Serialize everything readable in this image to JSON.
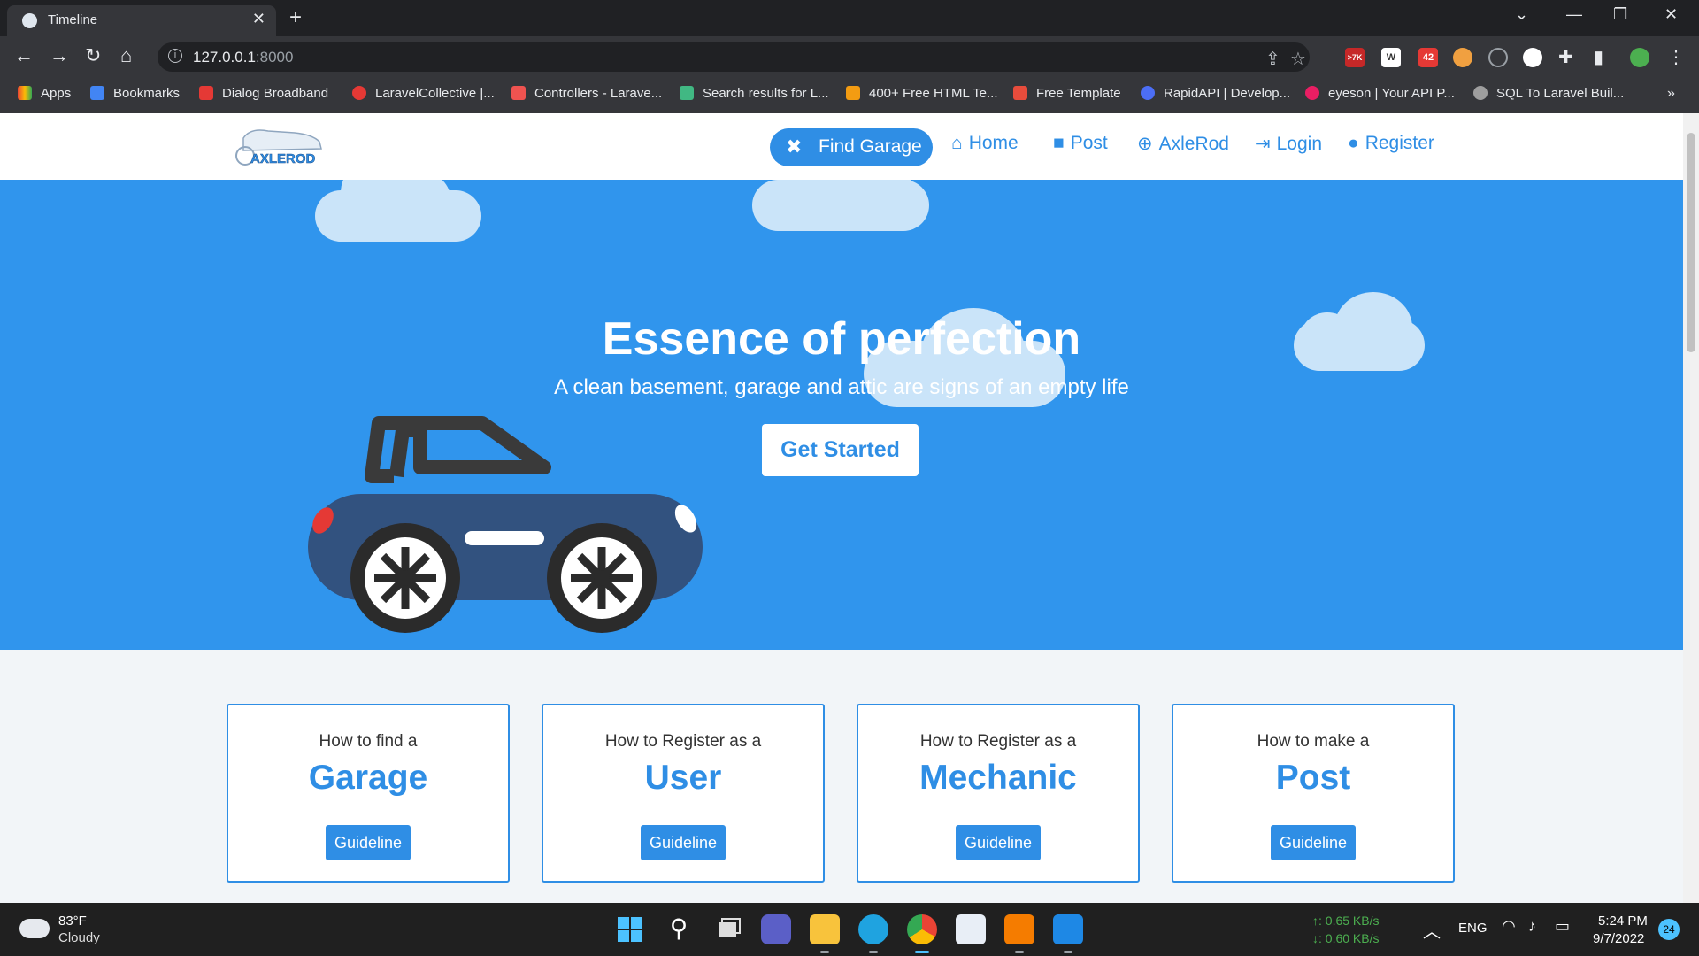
{
  "browser": {
    "tab_title": "Timeline",
    "new_tab": "+",
    "url_host": "127.0.0.1",
    "url_port": ":8000"
  },
  "bookmarks": [
    {
      "label": "Apps",
      "color": "#ea4335"
    },
    {
      "label": "Bookmarks",
      "color": "#4285f4"
    },
    {
      "label": "Dialog Broadband",
      "color": "#e53935"
    },
    {
      "label": "LaravelCollective |...",
      "color": "#e53935"
    },
    {
      "label": "Controllers - Larave...",
      "color": "#ef5350"
    },
    {
      "label": "Search results for L...",
      "color": "#41b883"
    },
    {
      "label": "400+ Free HTML Te...",
      "color": "#f39c12"
    },
    {
      "label": "Free Template",
      "color": "#e74c3c"
    },
    {
      "label": "RapidAPI | Develop...",
      "color": "#4c6ef5"
    },
    {
      "label": "eyeson | Your API P...",
      "color": "#e91e63"
    },
    {
      "label": "SQL To Laravel Buil...",
      "color": "#9e9e9e"
    }
  ],
  "extensions": {
    "badge_mail": ">7K",
    "badge_42": "42"
  },
  "site": {
    "logo_text": "AXLEROD",
    "nav": {
      "find_garage": "Find Garage",
      "home": "Home",
      "post": "Post",
      "axlerod": "AxleRod",
      "login": "Login",
      "register": "Register"
    },
    "hero": {
      "title": "Essence of perfection",
      "subtitle": "A clean basement, garage and attic are signs of an empty life",
      "cta": "Get Started"
    },
    "cards": [
      {
        "pre": "How to find a",
        "big": "Garage",
        "button": "Guideline"
      },
      {
        "pre": "How to Register as a",
        "big": "User",
        "button": "Guideline"
      },
      {
        "pre": "How to Register as a",
        "big": "Mechanic",
        "button": "Guideline"
      },
      {
        "pre": "How to make a",
        "big": "Post",
        "button": "Guideline"
      }
    ],
    "colors": {
      "primary": "#2f8ee5",
      "hero_bg": "#3095ed",
      "cloud": "#cae4f9",
      "car_body": "#32527f"
    }
  },
  "taskbar": {
    "weather_temp": "83°F",
    "weather_desc": "Cloudy",
    "net_up": "↑: 0.65 KB/s",
    "net_down": "↓: 0.60 KB/s",
    "lang": "ENG",
    "time": "5:24 PM",
    "date": "9/7/2022",
    "notifications": "24"
  }
}
